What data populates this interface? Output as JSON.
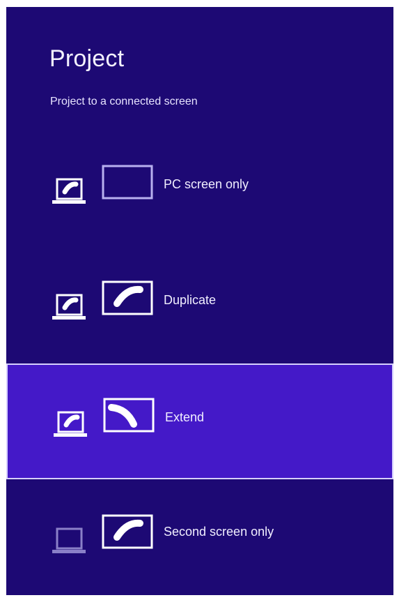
{
  "title": "Project",
  "subtitle": "Project to a connected screen",
  "options": [
    {
      "label": "PC screen only",
      "icon": "pc-screen-only-icon",
      "selected": false
    },
    {
      "label": "Duplicate",
      "icon": "duplicate-icon",
      "selected": false
    },
    {
      "label": "Extend",
      "icon": "extend-icon",
      "selected": true
    },
    {
      "label": "Second screen only",
      "icon": "second-screen-only-icon",
      "selected": false
    }
  ],
  "colors": {
    "background": "#1d0974",
    "selected_background": "#4419c8",
    "selected_border": "#d7d0ff",
    "text": "#f1efff"
  }
}
